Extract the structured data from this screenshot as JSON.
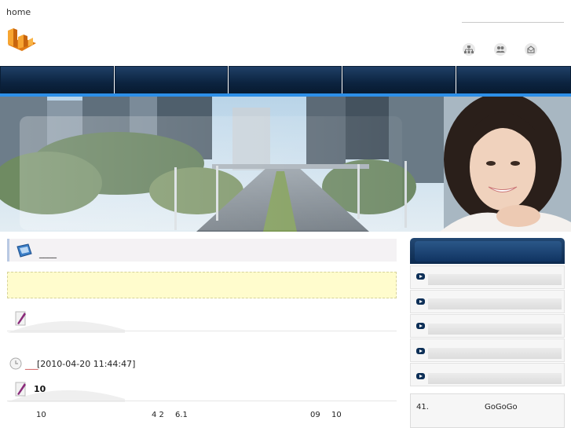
{
  "header": {
    "home_link": "home",
    "icons": [
      "sitemap-icon",
      "users-icon",
      "contact-icon"
    ]
  },
  "nav": {
    "tabs": [
      "",
      "",
      "",
      "",
      ""
    ]
  },
  "main": {
    "section_title": "____",
    "timestamp_marker": "___",
    "timestamp": "[2010-04-20 11:44:47]",
    "post_title": "10",
    "row": [
      "10",
      "4 2",
      "6.1",
      "09",
      "10"
    ]
  },
  "sidebar": {
    "items": [
      "",
      "",
      "",
      "",
      ""
    ],
    "box": {
      "number": "41.",
      "text": "GoGoGo"
    }
  },
  "colors": {
    "nav_dark": "#0c2440",
    "nav_accent": "#2d8fe8",
    "notice_bg": "#fffccd"
  }
}
